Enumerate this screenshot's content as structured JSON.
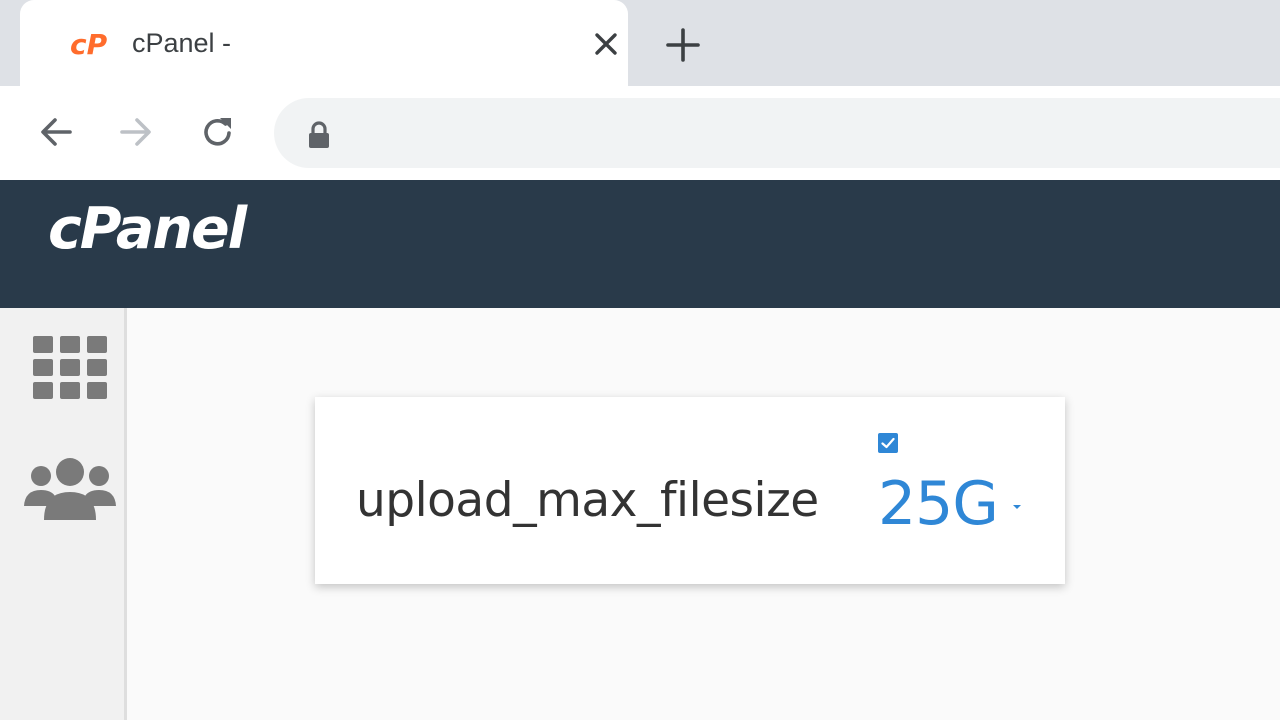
{
  "browser": {
    "tab": {
      "title": "cPanel -",
      "favicon": "cpanel-logo-icon",
      "favicon_color": "#ff6c2c"
    },
    "toolbar": {
      "back": "back-arrow-icon",
      "forward": "forward-arrow-icon",
      "reload": "reload-icon",
      "security": "lock-icon"
    }
  },
  "header": {
    "brand": "cPanel",
    "background_color": "#293a4a"
  },
  "sidebar": {
    "items": [
      {
        "icon": "apps-grid-icon"
      },
      {
        "icon": "users-icon"
      }
    ]
  },
  "setting": {
    "name": "upload_max_filesize",
    "checked": true,
    "value": "25G",
    "value_color": "#2f87d6"
  }
}
